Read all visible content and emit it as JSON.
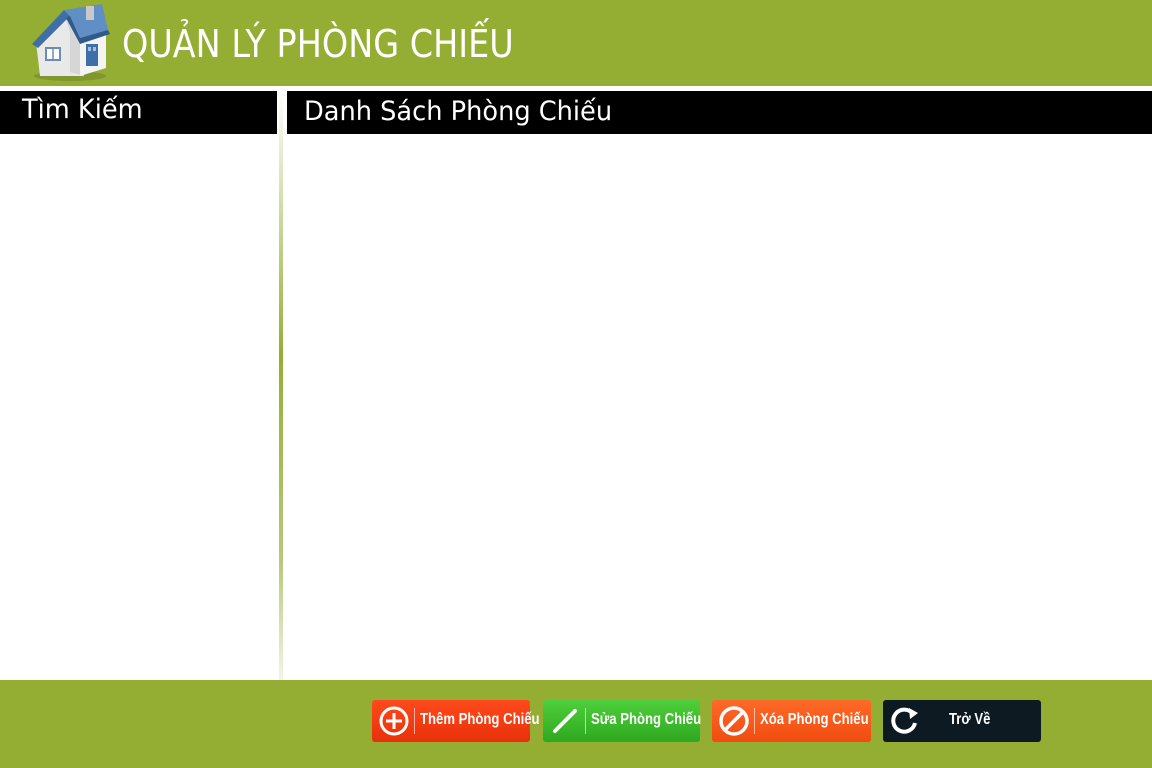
{
  "header": {
    "title": "QUẢN LÝ PHÒNG CHIẾU",
    "logo_icon": "house-icon"
  },
  "search_panel": {
    "title": "Tìm Kiếm"
  },
  "list_panel": {
    "title": "Danh Sách Phòng Chiếu"
  },
  "footer": {
    "buttons": [
      {
        "label": "Thêm Phòng Chiếu",
        "icon": "plus-circle-icon"
      },
      {
        "label": "Sửa Phòng Chiếu",
        "icon": "pencil-icon"
      },
      {
        "label": "Xóa Phòng Chiếu",
        "icon": "prohibit-icon"
      },
      {
        "label": "Trở Về",
        "icon": "refresh-icon"
      }
    ]
  },
  "colors": {
    "accent": "#94ae34",
    "panel_header": "#000000",
    "add": "#f03a12",
    "edit": "#3bbd2b",
    "delete": "#f45a18",
    "back": "#0d1a22"
  }
}
